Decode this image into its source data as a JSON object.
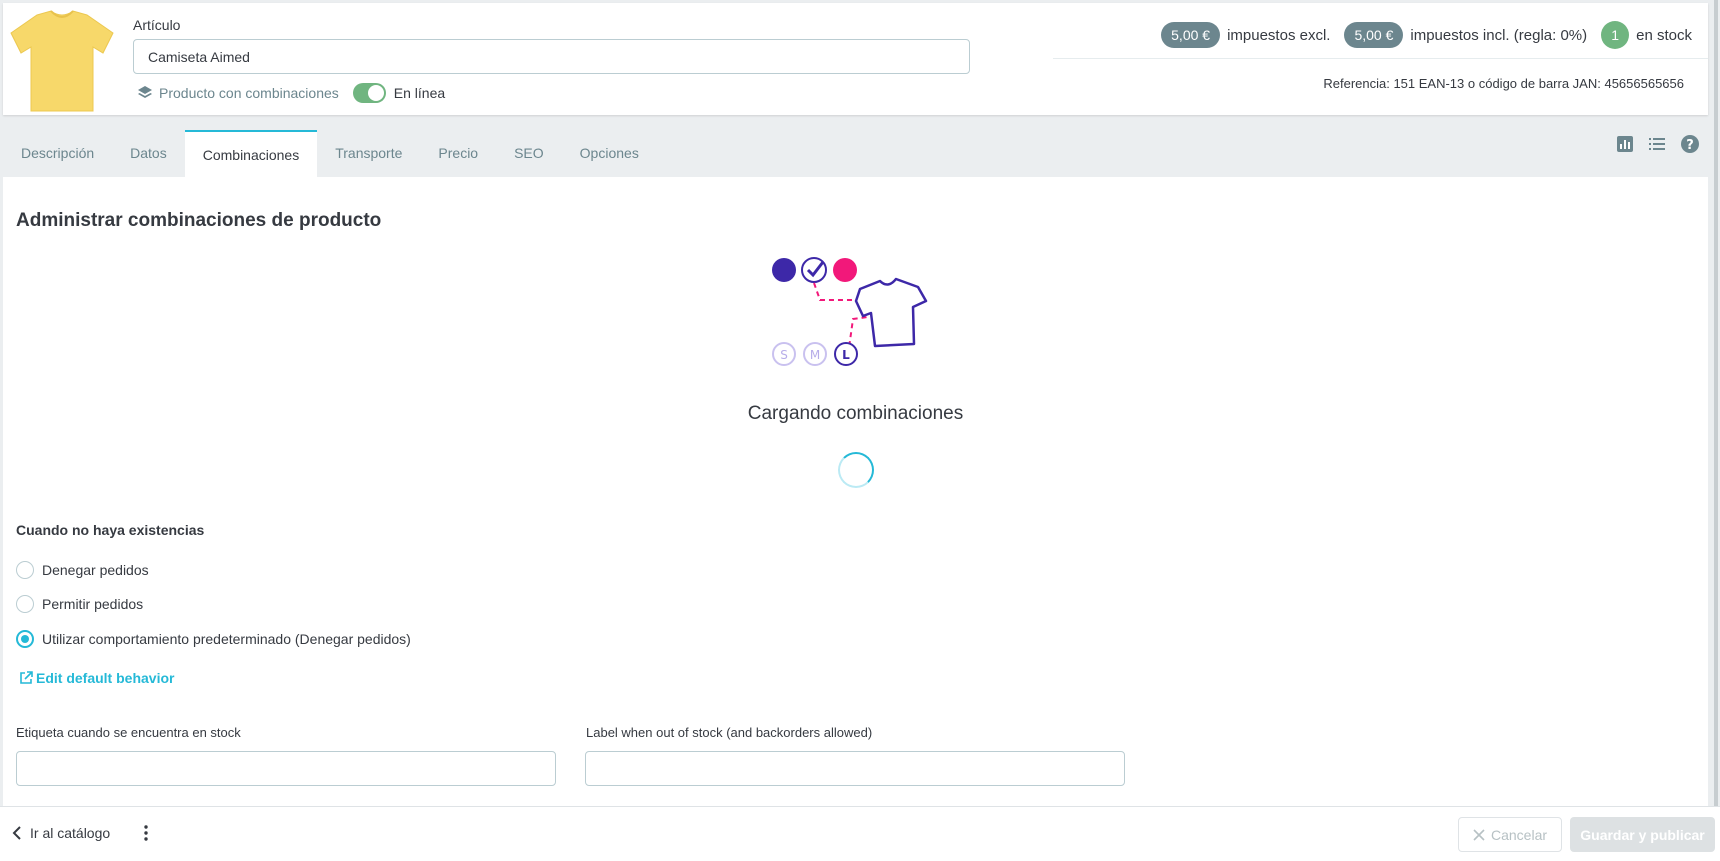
{
  "header": {
    "field_label": "Artículo",
    "name_value": "Camiseta Aimed",
    "combinations_label": "Producto con combinaciones",
    "online_label": "En línea",
    "online_enabled": true,
    "price_excl": "5,00 €",
    "price_excl_text": "impuestos excl.",
    "price_incl": "5,00 €",
    "price_incl_text": "impuestos incl. (regla: 0%)",
    "stock_count": "1",
    "stock_text": "en stock",
    "reference_line": "Referencia: 151   EAN-13 o código de barra JAN: 45656565656"
  },
  "tabs": [
    {
      "label": "Descripción",
      "active": false
    },
    {
      "label": "Datos",
      "active": false
    },
    {
      "label": "Combinaciones",
      "active": true
    },
    {
      "label": "Transporte",
      "active": false
    },
    {
      "label": "Precio",
      "active": false
    },
    {
      "label": "SEO",
      "active": false
    },
    {
      "label": "Opciones",
      "active": false
    }
  ],
  "tools": [
    "stats-icon",
    "list-icon",
    "help-icon"
  ],
  "main": {
    "title": "Administrar combinaciones de producto",
    "loading_text": "Cargando combinaciones",
    "sizes": [
      "S",
      "M",
      "L"
    ]
  },
  "out_of_stock": {
    "title": "Cuando no haya existencias",
    "options": [
      {
        "label": "Denegar pedidos",
        "checked": false
      },
      {
        "label": "Permitir pedidos",
        "checked": false
      },
      {
        "label": "Utilizar comportamiento predeterminado (Denegar pedidos)",
        "checked": true
      }
    ],
    "edit_link": "Edit default behavior",
    "in_stock_label": "Etiqueta cuando se encuentra en stock",
    "out_stock_label": "Label when out of stock (and backorders allowed)",
    "in_stock_value": "",
    "out_stock_value": ""
  },
  "footer": {
    "back_label": "Ir al catálogo",
    "cancel_label": "Cancelar",
    "save_label": "Guardar y publicar"
  },
  "colors": {
    "accent": "#25b9d7",
    "success": "#70b580",
    "pill": "#6c868e",
    "illustration_primary": "#3d28a8",
    "illustration_pink": "#f2187a",
    "shirt_yellow": "#f7d86a"
  }
}
